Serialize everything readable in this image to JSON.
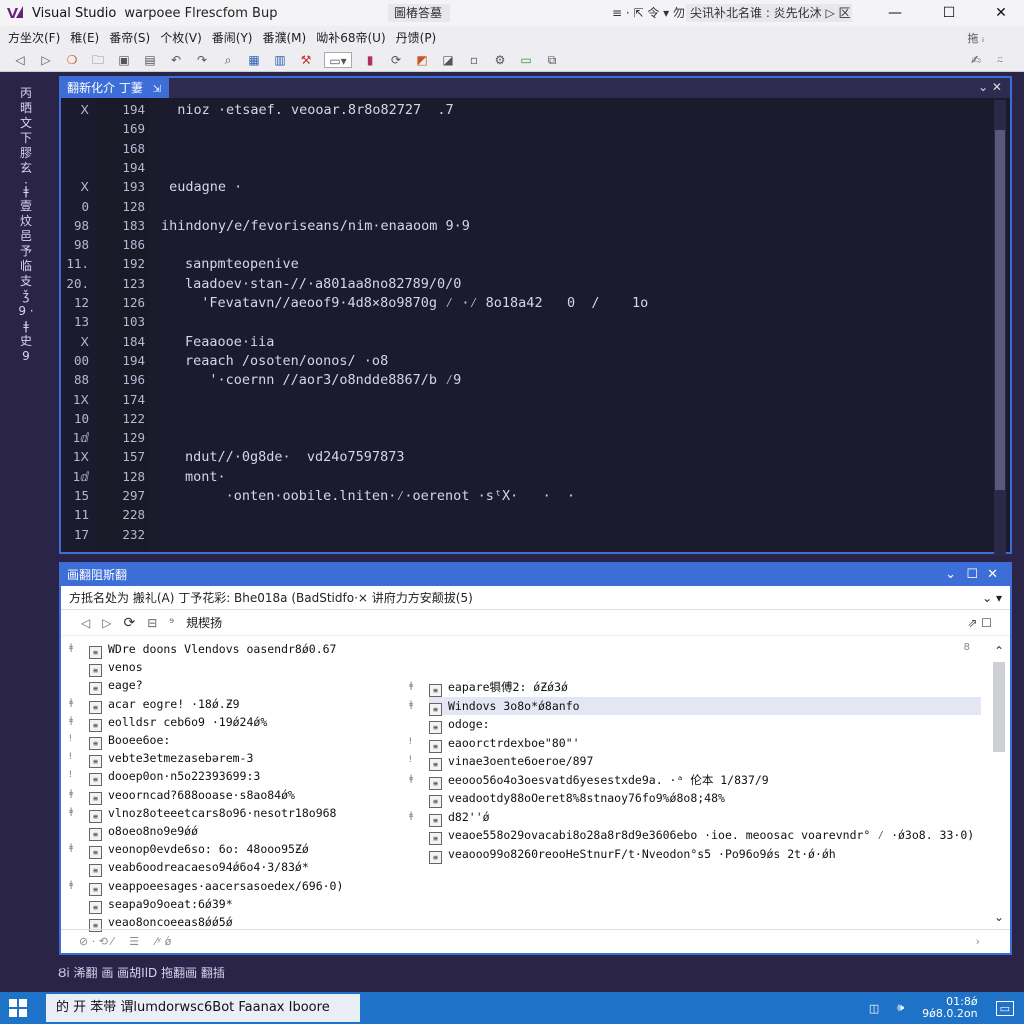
{
  "window": {
    "app_name": "Visual Studio",
    "doc_title": "warpoee Flrescfom Bup",
    "search_box": "圖樁答墓",
    "extra": "≡ ·   ⇱ 令 ▾ 勿 ⁹ ▾",
    "right_box": "尖讯补北名谁 : 炎先化沐 ▷ 区",
    "min": "—",
    "max": "☐",
    "close": "✕"
  },
  "menu": {
    "items": [
      "方坐次(F)",
      "稚(E)",
      "番帝(S)",
      "个枚(V)",
      "番闹(Y)",
      "番濮(M)",
      "呦补68帝(U)",
      "丹馈(P)"
    ],
    "right": "拖 ᵢ"
  },
  "editor": {
    "tab_label": "翻新化介 丁萋",
    "tab_pin": "⇲",
    "controls": "⌄  ✕",
    "gutter_a": [
      "Ⅹ",
      "",
      "",
      "",
      "Ⅹ",
      "0",
      "98",
      "98",
      "11.",
      "20.",
      "12",
      "13",
      "Ⅹ",
      "00",
      "88",
      "1Ⅹ",
      "10",
      "1ⅆ",
      "1Ⅹ",
      "1ⅆ",
      "15",
      "11",
      "17"
    ],
    "gutter_b": [
      "194",
      "169",
      "168",
      "194",
      "193",
      "128",
      "183",
      "186",
      "192",
      "123",
      "126",
      "103",
      "184",
      "194",
      "196",
      "174",
      "122",
      "129",
      "157",
      "128",
      "297",
      "228",
      "232"
    ],
    "code": [
      {
        "indent": 0,
        "text": "  nioz ·etsaef. veooar.8r8o82727  .7"
      },
      {
        "indent": 0,
        "text": ""
      },
      {
        "indent": 0,
        "text": ""
      },
      {
        "indent": 0,
        "text": ""
      },
      {
        "indent": 0,
        "text": " eudagne ·"
      },
      {
        "indent": 0,
        "text": ""
      },
      {
        "indent": 0,
        "text": "ihindony/e/fevoriseans/nim·enaaoom 9·9"
      },
      {
        "indent": 0,
        "text": ""
      },
      {
        "indent": 3,
        "text": "sanpmteopenive"
      },
      {
        "indent": 3,
        "text": "laadoev·stan-//·a801aa8no82789/0/0"
      },
      {
        "indent": 3,
        "text": "  'Fevatavn//aeoof9·4d8×8o9870g ⁄ ·⁄ 8o18a42   0  /    1o"
      },
      {
        "indent": 0,
        "text": ""
      },
      {
        "indent": 3,
        "text": "Feaaooe·iia"
      },
      {
        "indent": 3,
        "text": "reaach /osoten/oonos/ ·o8"
      },
      {
        "indent": 3,
        "text": "   '·coernn //aor3/o8ndde8867/b ⁄9"
      },
      {
        "indent": 0,
        "text": ""
      },
      {
        "indent": 0,
        "text": ""
      },
      {
        "indent": 0,
        "text": ""
      },
      {
        "indent": 3,
        "text": "ndut//·0g8de·  vd24o7597873"
      },
      {
        "indent": 3,
        "text": "mont·"
      },
      {
        "indent": 3,
        "text": "     ·onten·oobile.lniten·⁄·oerenot ·sᵗX·   ·  ·"
      },
      {
        "indent": 0,
        "text": ""
      },
      {
        "indent": 0,
        "text": ""
      }
    ]
  },
  "output": {
    "title": "画翻阻斯翻",
    "controls": [
      "⌄",
      "☐",
      "✕"
    ],
    "source_label": "方抵名处为  搬礼(A)  丁予花彩: Bhe018a (BadStidfo·× 讲府力方安颠拔(5)",
    "source_arrows": "⌄  ▾",
    "tools_label": "規楔扬",
    "tools_right": "⇗  ☐",
    "left_items": [
      {
        "text": "WDre doons Vlendovs oasendr8ǿ0.67",
        "exp": "ǂ"
      },
      {
        "text": "venos",
        "exp": ""
      },
      {
        "text": "eage?",
        "exp": ""
      },
      {
        "text": "acar eogre! ·18ǿ.Ƶ9",
        "exp": "ǂ"
      },
      {
        "text": "eolldsr ceb6o9 ·19ǿ24ǿ%",
        "exp": "ǂ"
      },
      {
        "text": "Booee6oe:",
        "exp": "ǃ"
      },
      {
        "text": "vebte3etmezasebərem-3",
        "exp": "ǃ"
      },
      {
        "text": "dooep0on·n5o22393699:3",
        "exp": "ǃ"
      },
      {
        "text": "veoorncad?688ooase·s8ao84ǿ%",
        "exp": "ǂ"
      },
      {
        "text": "vlnoz8oteeetcars8o96·nesotr18o968",
        "exp": "ǂ"
      },
      {
        "text": "o8oeo8no9e9ǿǿ",
        "exp": ""
      },
      {
        "text": "veonop0evde6so: 6o: 48ooo95Ƶǿ",
        "exp": "ǂ"
      },
      {
        "text": "veab6oodreacaeso94ǿ6o4·3/83ǿ*",
        "exp": ""
      },
      {
        "text": "veappoeesages·aacersasoedex/696·0)",
        "exp": "ǂ"
      },
      {
        "text": "seapa9o9oeat:6ǿ39*",
        "exp": ""
      },
      {
        "text": "veao8oncoeeas8ǿǿ5ǿ",
        "exp": ""
      }
    ],
    "right_items": [
      {
        "text": "eapare犋傅2: ǿƵǿ3ǿ",
        "exp": "ǂ"
      },
      {
        "text": "Windovs 3o8o*ǿ8anfo",
        "exp": "ǂ"
      },
      {
        "text": "odoge:",
        "exp": ""
      },
      {
        "text": "eaoorctrdexboe\"80\"'",
        "exp": "ǃ"
      },
      {
        "text": "vinae3oente6oeroe/897",
        "exp": "ǃ"
      },
      {
        "text": "eeooo56o4o3oesvatd6yesestxde9a.  ·ᵃ   伦本 1/837/9",
        "exp": "ǂ"
      },
      {
        "text": "veadootdy88oOeret8%8stnaoy76fo9%ǿ8o8;48%",
        "exp": ""
      },
      {
        "text": "d82''ǿ",
        "exp": "ǂ"
      },
      {
        "text": "veaoe558o29ovacabi8o28a8r8d9e3606ebo ·ioe.  meoosac voarevndr° ⁄ ·ǿ3o8. 33·0)",
        "exp": ""
      },
      {
        "text": "veaooo99o8260reooHeStnurF/t·Nveodon°s5  ·Po96o9ǿs 2t·ǿ·ǿh",
        "exp": ""
      }
    ],
    "scroll_top": "8",
    "footer": [
      "⊘ ·  ⟲  ⁄",
      "☰",
      "⁄ʸ ǿ"
    ]
  },
  "status": {
    "text": "Ȣi  浠翻 画 画胡IlD   拖翻画  翻插"
  },
  "taskbar": {
    "item": "的 开 苯带 谓lumdorwsc6Bot Faanax Iboore",
    "clock_time": "01:8ǿ",
    "clock_date": "9ǿ8.0.2on"
  },
  "colors": {
    "accent": "#3d6ed8",
    "editor_bg": "#1c1b2e",
    "shell_bg": "#2a2548",
    "taskbar": "#1e73c8",
    "vs_purple": "#68217a"
  }
}
